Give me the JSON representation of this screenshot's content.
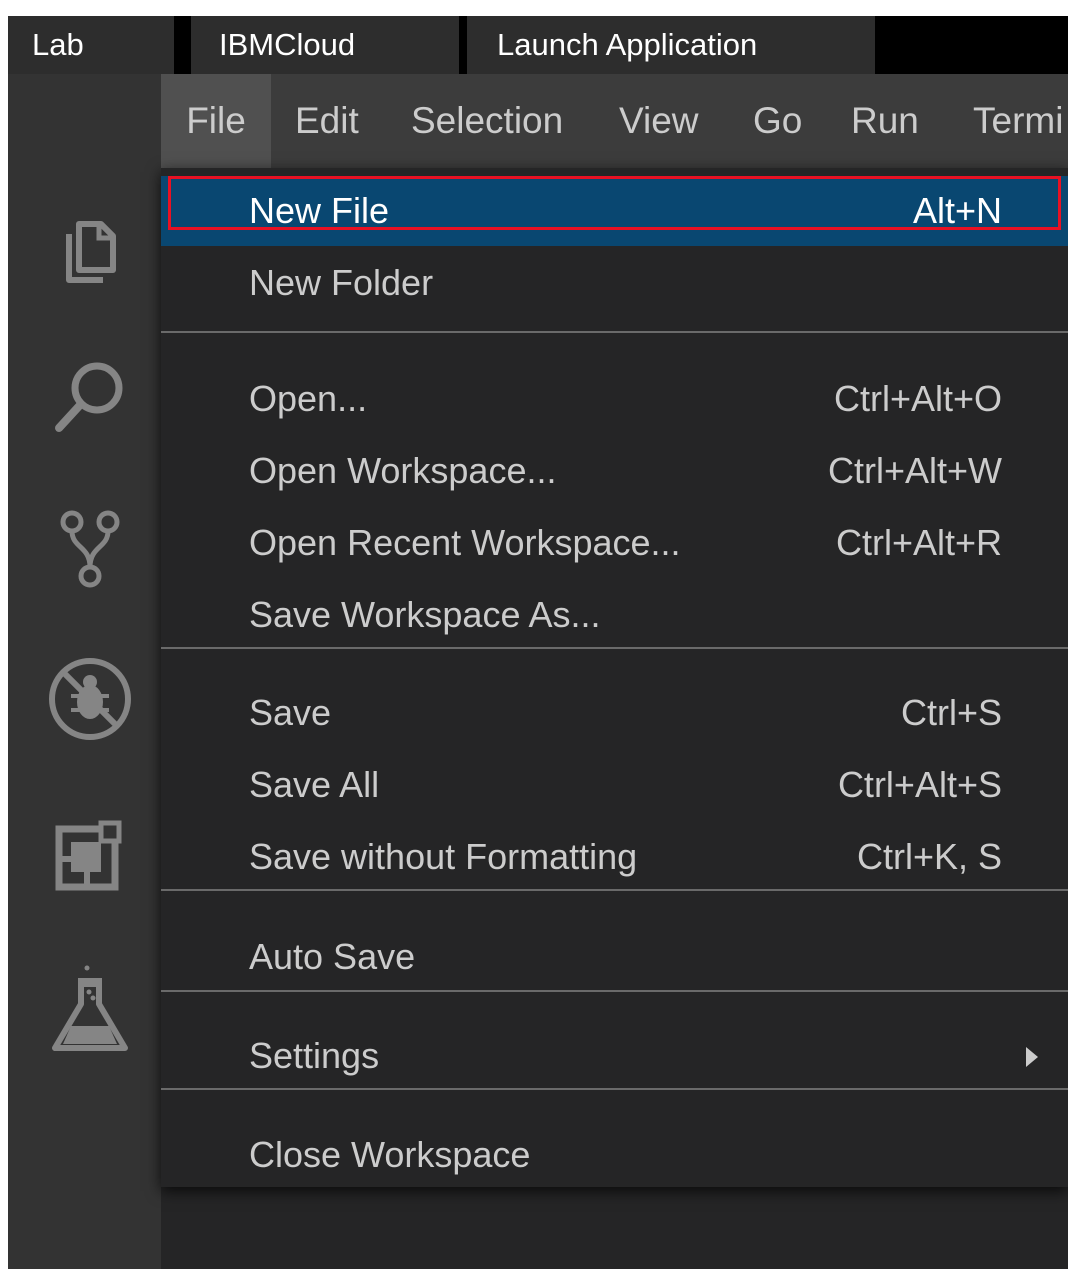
{
  "tabs": [
    {
      "label": "Lab"
    },
    {
      "label": "IBMCloud"
    },
    {
      "label": "Launch Application"
    }
  ],
  "activity_bar": {
    "icons": [
      "explorer-icon",
      "search-icon",
      "source-control-icon",
      "debug-icon",
      "extensions-icon",
      "testing-flask-icon"
    ]
  },
  "menubar": {
    "items": [
      "File",
      "Edit",
      "Selection",
      "View",
      "Go",
      "Run",
      "Termi"
    ],
    "active": "File"
  },
  "file_menu": {
    "new_file": {
      "label": "New File",
      "shortcut": "Alt+N"
    },
    "new_folder": {
      "label": "New Folder"
    },
    "open": {
      "label": "Open...",
      "shortcut": "Ctrl+Alt+O"
    },
    "open_workspace": {
      "label": "Open Workspace...",
      "shortcut": "Ctrl+Alt+W"
    },
    "open_recent_workspace": {
      "label": "Open Recent Workspace...",
      "shortcut": "Ctrl+Alt+R"
    },
    "save_workspace_as": {
      "label": "Save Workspace As..."
    },
    "save": {
      "label": "Save",
      "shortcut": "Ctrl+S"
    },
    "save_all": {
      "label": "Save All",
      "shortcut": "Ctrl+Alt+S"
    },
    "save_without_formatting": {
      "label": "Save without Formatting",
      "shortcut": "Ctrl+K, S"
    },
    "auto_save": {
      "label": "Auto Save"
    },
    "settings": {
      "label": "Settings"
    },
    "close_workspace": {
      "label": "Close Workspace"
    }
  },
  "colors": {
    "highlight_bg": "#094771",
    "highlight_outline": "#e81123",
    "menubar_bg": "#3c3c3c",
    "menu_bg": "#252526",
    "activity_bar_bg": "#333333"
  }
}
